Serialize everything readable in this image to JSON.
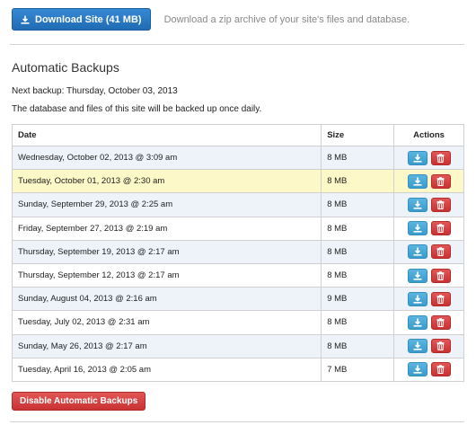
{
  "download": {
    "button_label": "Download Site (41 MB)",
    "description": "Download a zip archive of your site's files and database."
  },
  "backups": {
    "title": "Automatic Backups",
    "next_backup": "Next backup: Thursday, October 03, 2013",
    "note": "The database and files of this site will be backed up once daily.",
    "columns": [
      "Date",
      "Size",
      "Actions"
    ],
    "rows": [
      {
        "date": "Wednesday, October 02, 2013 @ 3:09 am",
        "size": "8 MB"
      },
      {
        "date": "Tuesday, October 01, 2013 @ 2:30 am",
        "size": "8 MB"
      },
      {
        "date": "Sunday, September 29, 2013 @ 2:25 am",
        "size": "8 MB"
      },
      {
        "date": "Friday, September 27, 2013 @ 2:19 am",
        "size": "8 MB"
      },
      {
        "date": "Thursday, September 19, 2013 @ 2:17 am",
        "size": "8 MB"
      },
      {
        "date": "Thursday, September 12, 2013 @ 2:17 am",
        "size": "8 MB"
      },
      {
        "date": "Sunday, August 04, 2013 @ 2:16 am",
        "size": "9 MB"
      },
      {
        "date": "Tuesday, July 02, 2013 @ 2:31 am",
        "size": "8 MB"
      },
      {
        "date": "Sunday, May 26, 2013 @ 2:17 am",
        "size": "8 MB"
      },
      {
        "date": "Tuesday, April 16, 2013 @ 2:05 am",
        "size": "7 MB"
      }
    ],
    "row_actions": {
      "download_icon": "download-icon",
      "delete_icon": "trash-icon"
    },
    "disable_label": "Disable Automatic Backups"
  },
  "colors": {
    "primary": "#2a78c2",
    "info": "#3a9bcc",
    "danger": "#c93232",
    "row_highlight": "#fcf8c8",
    "row_alt": "#edf3f9"
  }
}
